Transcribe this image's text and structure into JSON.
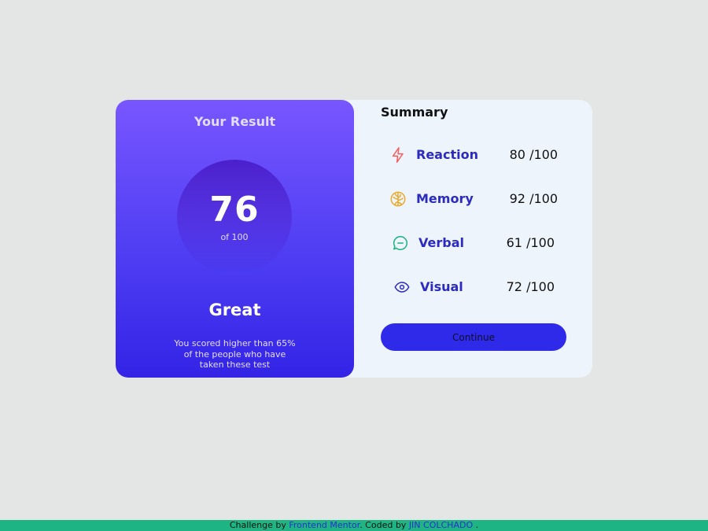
{
  "result": {
    "title": "Your Result",
    "score": "76",
    "score_of": "of 100",
    "rating": "Great",
    "description": "You scored higher than 65% of the people who have taken these test"
  },
  "summary": {
    "title": "Summary",
    "items": [
      {
        "label": "Reaction",
        "score": "80 /100",
        "icon": "lightning-icon",
        "color": "#f55c5c"
      },
      {
        "label": "Memory",
        "score": "92 /100",
        "icon": "brain-icon",
        "color": "#f0a419"
      },
      {
        "label": "Verbal",
        "score": "61 /100",
        "icon": "chat-bubble-icon",
        "color": "#1ab07f"
      },
      {
        "label": "Visual",
        "score": "72 /100",
        "icon": "eye-icon",
        "color": "#2b2bc0"
      }
    ],
    "continue_label": "Continue"
  },
  "footer": {
    "prefix": "Challenge by",
    "challenge_link": "Frontend Mentor",
    "middle": ". Coded by",
    "author_link": "JIN COLCHADO",
    "suffix": "."
  },
  "colors": {
    "background": "#e4e6e6",
    "card": "#eef4fc",
    "accent": "#2f2ae9",
    "footer": "#1fb483"
  }
}
